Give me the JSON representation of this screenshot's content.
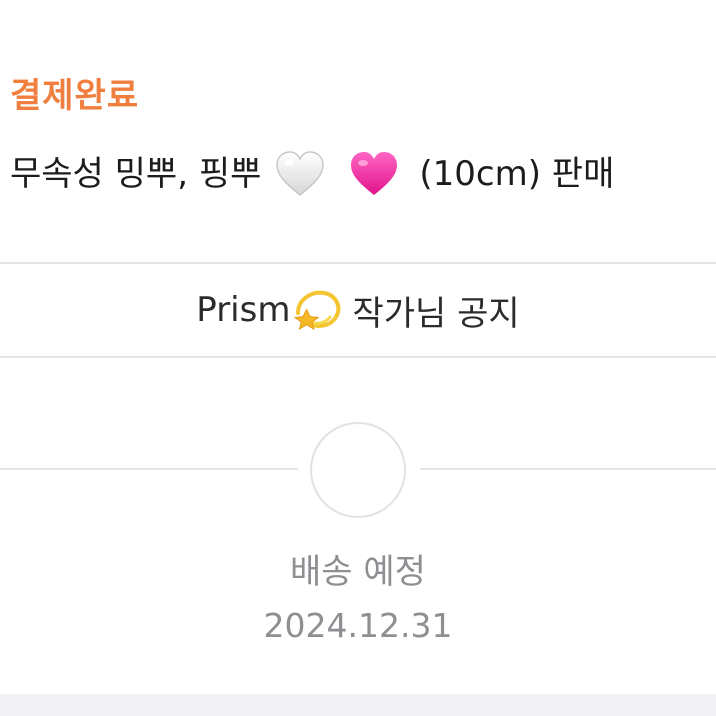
{
  "order": {
    "status_label": "결제완료",
    "product_title_part1": "무속성 밍뿌, 핑뿌",
    "product_title_part2": "(10cm) 판매",
    "title_icons": [
      "white-heart-icon",
      "pink-heart-icon"
    ]
  },
  "notice": {
    "prefix": "Prism",
    "suffix": "작가님 공지",
    "icon": "dizzy-icon"
  },
  "delivery": {
    "label": "배송 예정",
    "date": "2024.12.31"
  },
  "colors": {
    "status_accent": "#f07e3e",
    "divider": "#e6e6ea",
    "muted_text": "#8e8e93",
    "pink_heart": "#ff2fa6"
  }
}
